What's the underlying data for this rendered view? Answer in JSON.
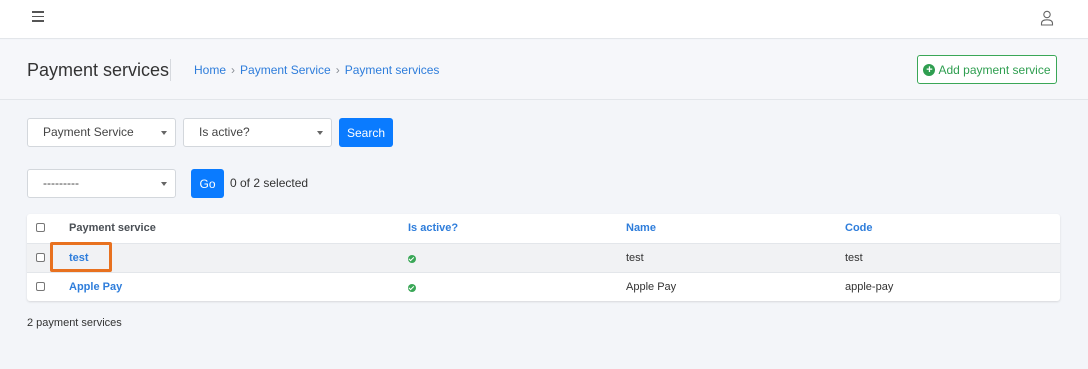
{
  "topbar": {
    "menu_icon": "hamburger-menu-icon",
    "user_icon": "user-icon"
  },
  "header": {
    "title": "Payment services",
    "breadcrumb": [
      "Home",
      "Payment Service",
      "Payment services"
    ],
    "add_button": "Add payment service"
  },
  "filters": {
    "service_select": "Payment Service",
    "active_select": "Is active?",
    "search_button": "Search"
  },
  "actions": {
    "action_select": "---------",
    "go_button": "Go",
    "selected_text": "0 of 2 selected"
  },
  "table": {
    "columns": [
      "Payment service",
      "Is active?",
      "Name",
      "Code"
    ],
    "rows": [
      {
        "service": "test",
        "active": true,
        "name": "test",
        "code": "test"
      },
      {
        "service": "Apple Pay",
        "active": true,
        "name": "Apple Pay",
        "code": "apple-pay"
      }
    ]
  },
  "footer": {
    "count_text": "2 payment services"
  },
  "colors": {
    "accent": "#0a7bff",
    "link": "#2e7ddb",
    "success": "#3aa757",
    "highlight": "#e8711f"
  }
}
